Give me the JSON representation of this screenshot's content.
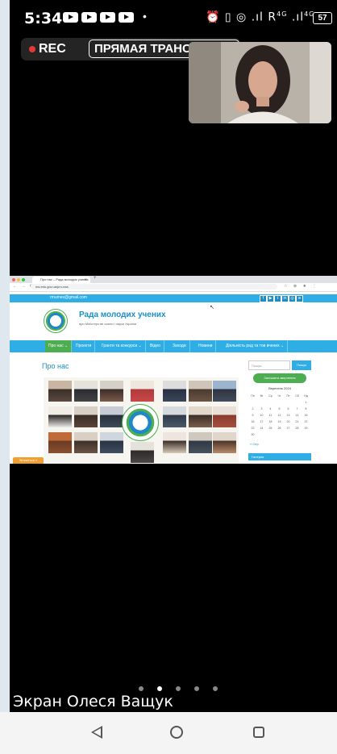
{
  "status_bar": {
    "time": "5:34",
    "indicators": "⏰ ▯ ◎ .ıl R",
    "network_4g_a": "4G",
    "network_4g_b": "4G",
    "battery": "57"
  },
  "recording": {
    "rec_label": "REC",
    "live_label": "ПРЯМАЯ ТРАНСЛЯЦИЯ",
    "rec_color": "#e53935"
  },
  "shared_screen": {
    "browser": {
      "tab_title": "Про нас – Рада молодих учених",
      "url": "ms.edu.gov.ua/pro-nas"
    },
    "site": {
      "email": "rmumes@gmail.com",
      "social_icons": [
        "facebook-icon",
        "youtube-icon",
        "twitter-icon",
        "linkedin-icon",
        "instagram-icon",
        "rss-icon"
      ],
      "title": "Рада молодих учених",
      "subtitle": "при Міністерстві освіти і науки України",
      "menu": [
        "Про нас ⌄",
        "Проекти",
        "Гранти та конкурси ⌄",
        "Відео",
        "Заходи",
        "Новини",
        "Діяльність рад та тов вчених ⌄"
      ],
      "page_heading": "Про нас",
      "search_placeholder": "Пошук...",
      "search_button": "Пошук",
      "appeal_button": "Залишити звернення",
      "calendar_title": "Вересень 2024",
      "calendar_days": [
        "Пн",
        "Вт",
        "Ср",
        "Чт",
        "Пт",
        "Сб",
        "Нд"
      ],
      "calendar_weeks": [
        [
          "",
          "",
          "",
          "",
          "",
          "",
          "1"
        ],
        [
          "2",
          "3",
          "4",
          "5",
          "6",
          "7",
          "8"
        ],
        [
          "9",
          "10",
          "11",
          "12",
          "13",
          "14",
          "15"
        ],
        [
          "16",
          "17",
          "18",
          "19",
          "20",
          "21",
          "22"
        ],
        [
          "23",
          "24",
          "25",
          "26",
          "27",
          "28",
          "29"
        ],
        [
          "30",
          "",
          "",
          "",
          "",
          "",
          ""
        ]
      ],
      "calendar_prev": "« Сер",
      "gallery_label": "Галерея",
      "chat_tab": "Зв’яжіться »",
      "brand_color": "#2eaee5",
      "accent_color": "#4cae50"
    }
  },
  "footer": {
    "screen_label": "Экран Олеся Ващук",
    "page_count": 5,
    "active_page": 2
  },
  "navbar": {
    "back_icon": "back-triangle-icon",
    "home_icon": "home-circle-icon",
    "recents_icon": "recents-square-icon"
  }
}
